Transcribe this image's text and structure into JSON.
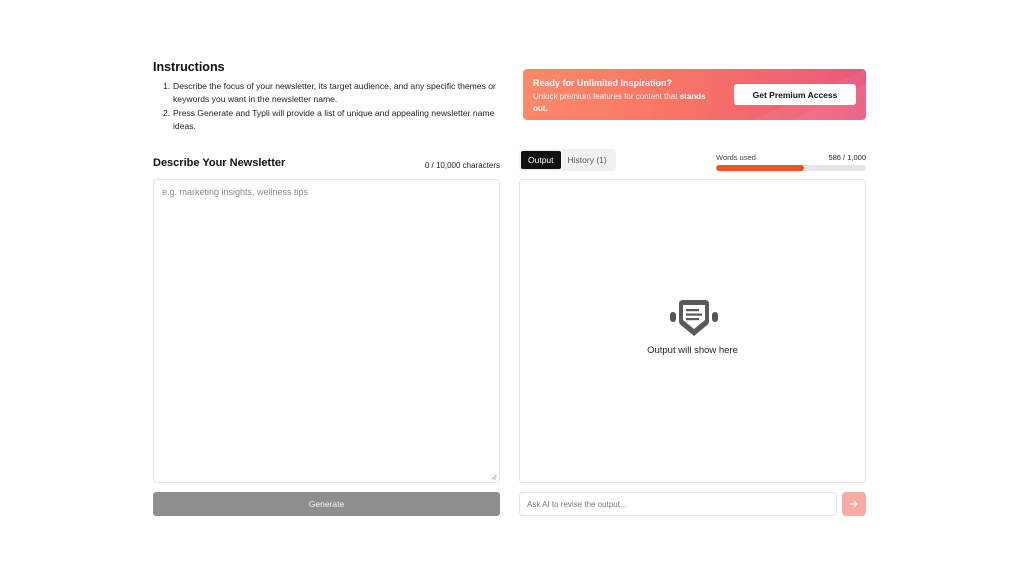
{
  "instructions": {
    "title": "Instructions",
    "steps": [
      {
        "num": "1.",
        "text": "Describe the focus of your newsletter, its target audience, and any specific themes or keywords you want in the newsletter name."
      },
      {
        "num": "2.",
        "text": "Press Generate and Typli will provide a list of unique and appealing newsletter name ideas."
      }
    ]
  },
  "promo": {
    "title": "Ready for Unlimited Inspiration?",
    "subtitle_part1": "Unlock premium features for content that ",
    "subtitle_bold": "stands out.",
    "button_label": "Get Premium Access",
    "gradient_start": "#fb8a6a",
    "gradient_end": "#e8527c"
  },
  "input_panel": {
    "title": "Describe Your Newsletter",
    "char_count": "0 / 10,000 characters",
    "placeholder": "e.g. marketing insights, wellness tips",
    "generate_label": "Generate"
  },
  "output_panel": {
    "tabs": [
      {
        "label": "Output",
        "active": true
      },
      {
        "label": "History (1)",
        "active": false
      }
    ],
    "words_label": "Words used",
    "words_value": "586 / 1,000",
    "words_fraction": 0.586,
    "progress_color": "#e7561d",
    "empty_icon": "message-badge-icon",
    "empty_text": "Output will show here",
    "revise_placeholder": "Ask AI to revise the output...",
    "send_icon": "arrow-right-icon",
    "send_color": "#f9aaa4"
  }
}
